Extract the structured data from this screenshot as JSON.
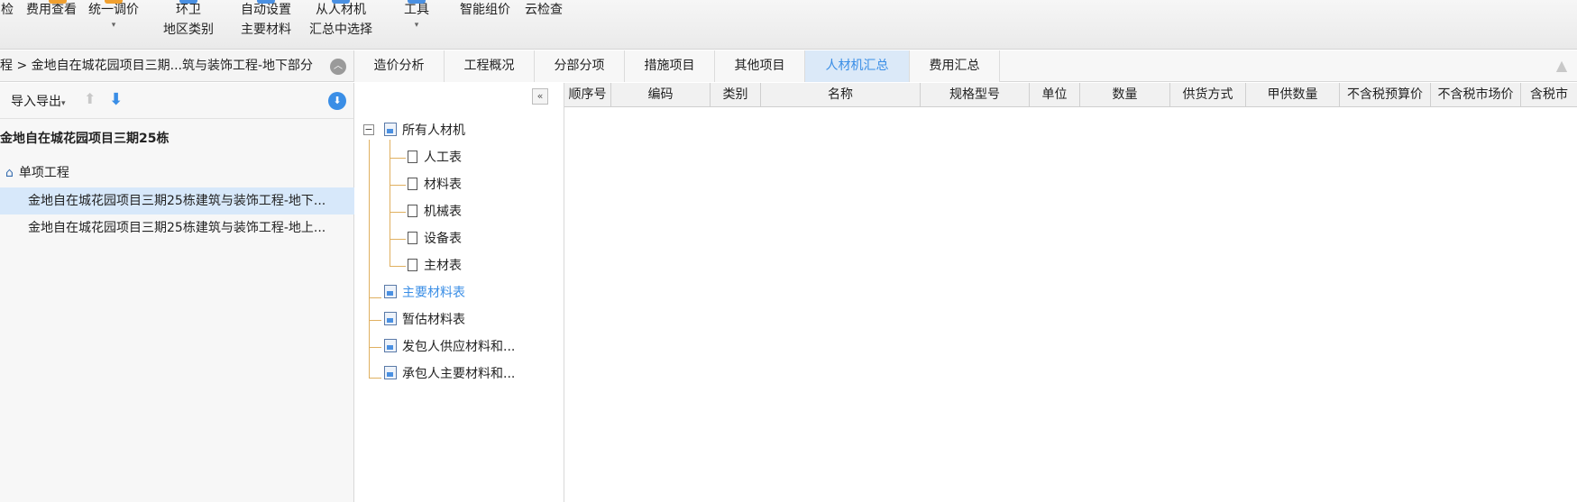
{
  "ribbon": {
    "items": [
      {
        "lines": [
          "检"
        ]
      },
      {
        "lines": [
          "费用查看"
        ]
      },
      {
        "lines": [
          "统一调价"
        ]
      },
      {
        "lines": [
          "环卫",
          "地区类别"
        ]
      },
      {
        "lines": [
          "自动设置",
          "主要材料"
        ]
      },
      {
        "lines": [
          "从人材机",
          "汇总中选择"
        ]
      },
      {
        "lines": [
          "工具"
        ]
      },
      {
        "lines": [
          "智能组价"
        ]
      },
      {
        "lines": [
          "云检查"
        ]
      }
    ]
  },
  "breadcrumb": {
    "text": "程 > 金地自在城花园项目三期...筑与装饰工程-地下部分"
  },
  "tabs": [
    "造价分析",
    "工程概况",
    "分部分项",
    "措施项目",
    "其他项目",
    "人材机汇总",
    "费用汇总"
  ],
  "left_panel": {
    "import_export_label": "导入导出",
    "project_title": "金地自在城花园项目三期25栋",
    "unit_label": "单项工程",
    "items": [
      "金地自在城花园项目三期25栋建筑与装饰工程-地下...",
      "金地自在城花园项目三期25栋建筑与装饰工程-地上..."
    ]
  },
  "tree": {
    "root": "所有人材机",
    "children": [
      "人工表",
      "材料表",
      "机械表",
      "设备表",
      "主材表"
    ],
    "others": [
      "主要材料表",
      "暂估材料表",
      "发包人供应材料和...",
      "承包人主要材料和..."
    ]
  },
  "grid": {
    "columns": [
      "顺序号",
      "编码",
      "类别",
      "名称",
      "规格型号",
      "单位",
      "数量",
      "供货方式",
      "甲供数量",
      "不含税预算价",
      "不含税市场价",
      "含税市"
    ]
  },
  "colors": {
    "accent": "#3a8ee6",
    "active_tab_bg": "#dbe9f8",
    "selected_row_bg": "#d7e8fa"
  }
}
